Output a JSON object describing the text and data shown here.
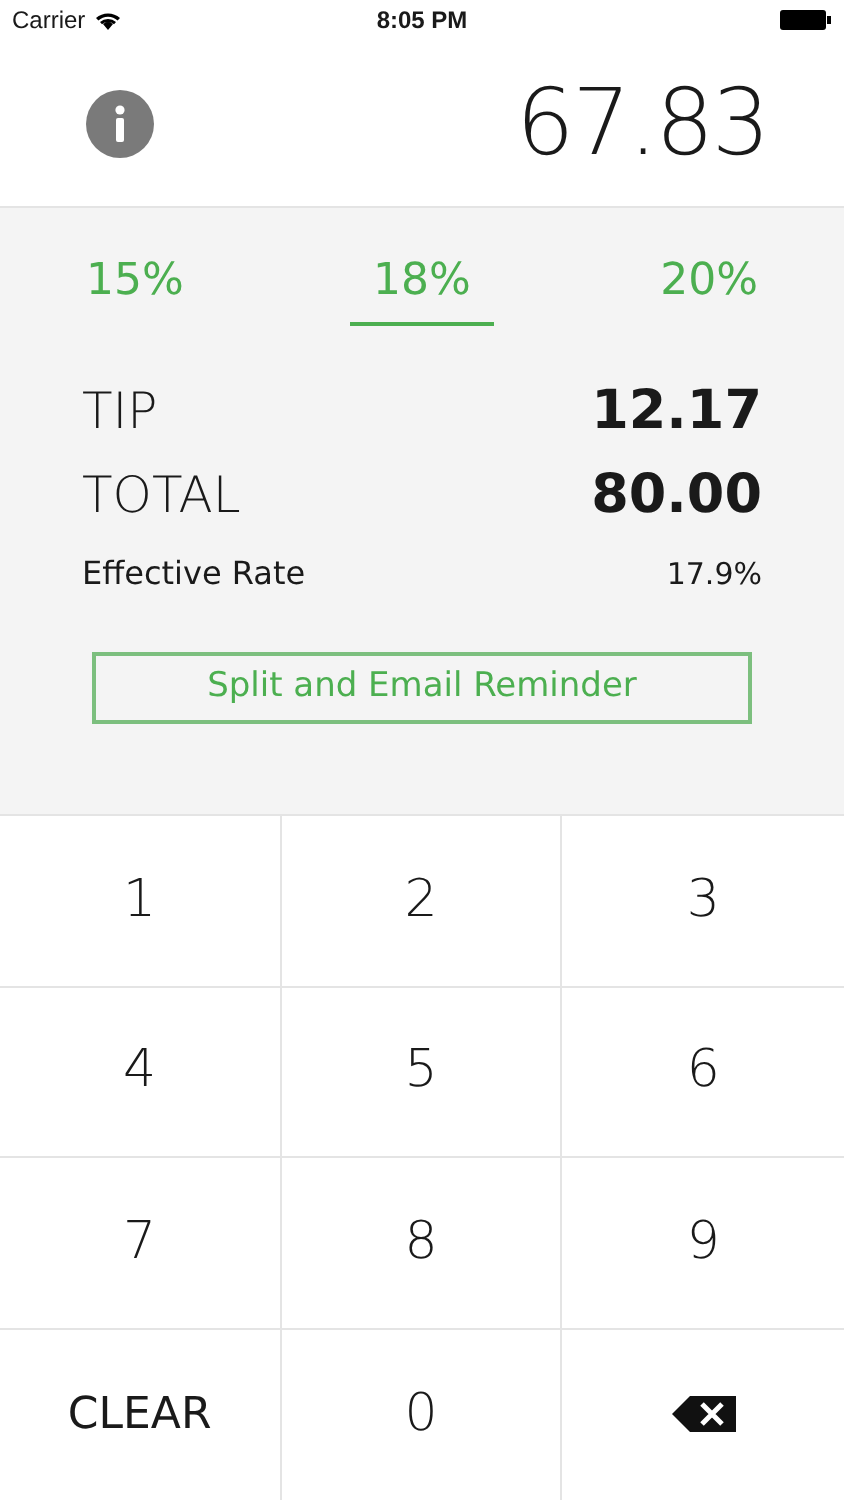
{
  "status_bar": {
    "carrier": "Carrier",
    "time": "8:05 PM"
  },
  "bill_amount": "67.83",
  "tip_options": [
    {
      "label": "15%",
      "selected": false
    },
    {
      "label": "18%",
      "selected": true
    },
    {
      "label": "20%",
      "selected": false
    }
  ],
  "results": [
    {
      "label": "TIP",
      "value": "12.17"
    },
    {
      "label": "TOTAL",
      "value": "80.00"
    }
  ],
  "effective_rate": {
    "label": "Effective Rate",
    "value": "17.9%"
  },
  "split_button": "Split and Email Reminder",
  "keypad": [
    {
      "kind": "digit",
      "label": "1"
    },
    {
      "kind": "digit",
      "label": "2"
    },
    {
      "kind": "digit",
      "label": "3"
    },
    {
      "kind": "digit",
      "label": "4"
    },
    {
      "kind": "digit",
      "label": "5"
    },
    {
      "kind": "digit",
      "label": "6"
    },
    {
      "kind": "digit",
      "label": "7"
    },
    {
      "kind": "digit",
      "label": "8"
    },
    {
      "kind": "digit",
      "label": "9"
    },
    {
      "kind": "text",
      "label": "CLEAR"
    },
    {
      "kind": "digit",
      "label": "0"
    },
    {
      "kind": "backspace"
    }
  ]
}
